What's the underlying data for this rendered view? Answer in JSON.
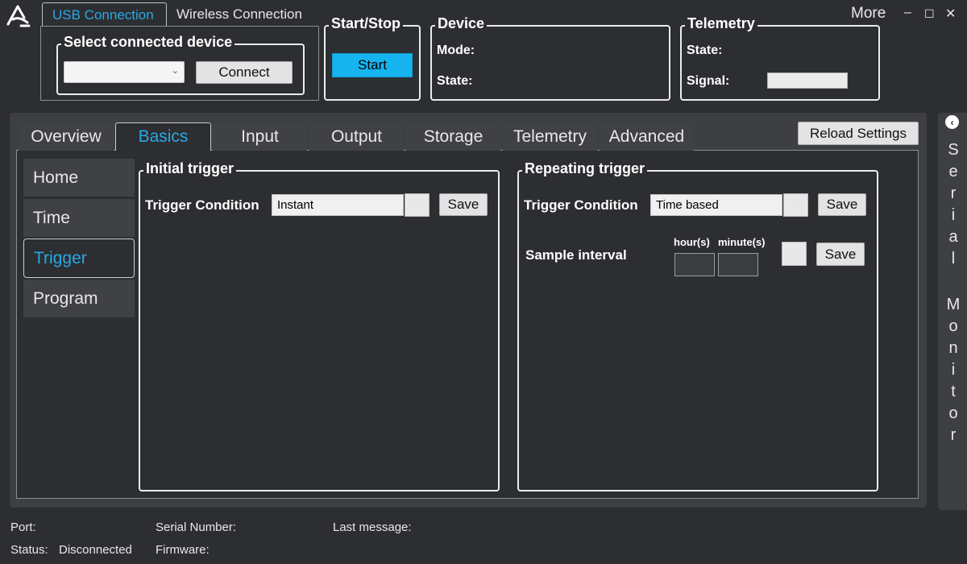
{
  "connection_tabs": {
    "usb": "USB Connection",
    "wireless": "Wireless Connection"
  },
  "select_device": {
    "title": "Select connected device",
    "selected_value": "",
    "connect_label": "Connect"
  },
  "start_stop": {
    "title": "Start/Stop",
    "start_label": "Start"
  },
  "device": {
    "title": "Device",
    "mode_label": "Mode:",
    "state_label": "State:"
  },
  "telemetry": {
    "title": "Telemetry",
    "state_label": "State:",
    "signal_label": "Signal:"
  },
  "window": {
    "more_label": "More",
    "minimize": "–",
    "maximize": "☐",
    "close": "✕"
  },
  "main_tabs": [
    "Overview",
    "Basics",
    "Input",
    "Output",
    "Storage",
    "Telemetry",
    "Advanced"
  ],
  "active_tab": "Basics",
  "reload_label": "Reload Settings",
  "sidebar": [
    "Home",
    "Time",
    "Trigger",
    "Program"
  ],
  "active_sidebar": "Trigger",
  "initial_trigger": {
    "title": "Initial trigger",
    "condition_label": "Trigger Condition",
    "condition_value": "Instant",
    "save_label": "Save"
  },
  "repeating_trigger": {
    "title": "Repeating trigger",
    "condition_label": "Trigger Condition",
    "condition_value": "Time based",
    "save_label": "Save",
    "interval_label": "Sample interval",
    "hours_label": "hour(s)",
    "minutes_label": "minute(s)",
    "interval_save_label": "Save"
  },
  "serial_monitor": {
    "label": "Serial Monitor",
    "collapse_icon": "chevron-left-icon"
  },
  "status_bar": {
    "port_label": "Port:",
    "status_label": "Status:",
    "status_value": "Disconnected",
    "serial_label": "Serial Number:",
    "firmware_label": "Firmware:",
    "last_message_label": "Last message:"
  },
  "colors": {
    "accent": "#27a9e6",
    "start": "#16b4ef",
    "background": "#2d2e31"
  }
}
